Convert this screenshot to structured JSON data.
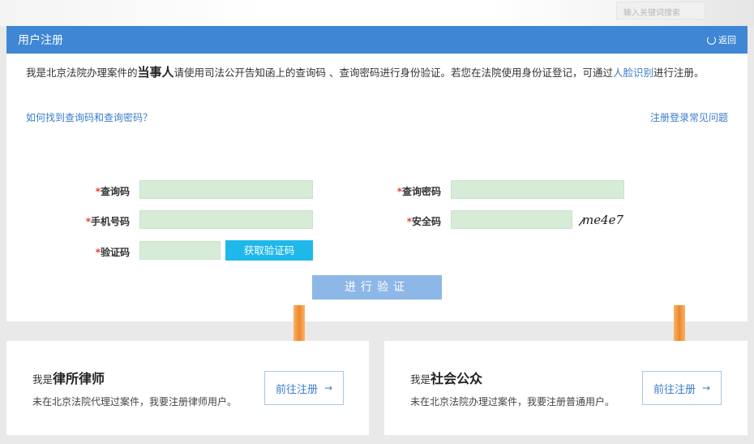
{
  "header": {
    "search_placeholder": "输入关键词搜索"
  },
  "panel": {
    "title": "用户注册",
    "back_label": "返回",
    "intro_part1": "我是北京法院办理案件的",
    "intro_emphasis": "当事人",
    "intro_part2": "请使用司法公开告知函上的查询码 、查询密码进行身份验证。若您在法院使用身份证登记，可通过",
    "intro_link": "人脸识别",
    "intro_part3": "进行注册。",
    "find_code_link": "如何找到查询码和查询密码？",
    "faq_link": "注册登录常见问题"
  },
  "form": {
    "required_mark": "*",
    "query_code_label": "查询码",
    "query_password_label": "查询密码",
    "phone_label": "手机号码",
    "security_code_label": "安全码",
    "verify_code_label": "验证码",
    "get_code_button": "获取验证码",
    "captcha_text": "me4e7",
    "submit_button": "进行验证"
  },
  "cards": [
    {
      "prefix": "我是",
      "title": "律所律师",
      "desc": "未在北京法院代理过案件，我要注册律师用户。",
      "button": "前往注册",
      "button_arrow": "→"
    },
    {
      "prefix": "我是",
      "title": "社会公众",
      "desc": "未在北京法院办理过案件，我要注册普通用户。",
      "button": "前往注册",
      "button_arrow": "→"
    }
  ],
  "colors": {
    "header_blue": "#3f86d5",
    "link_blue": "#3a7cc9",
    "input_green": "#d6ecd7",
    "sms_button": "#1fb8ea",
    "verify_button": "#8db7e6",
    "arrow_orange": "#f39a3c",
    "required_red": "#e0453b"
  }
}
